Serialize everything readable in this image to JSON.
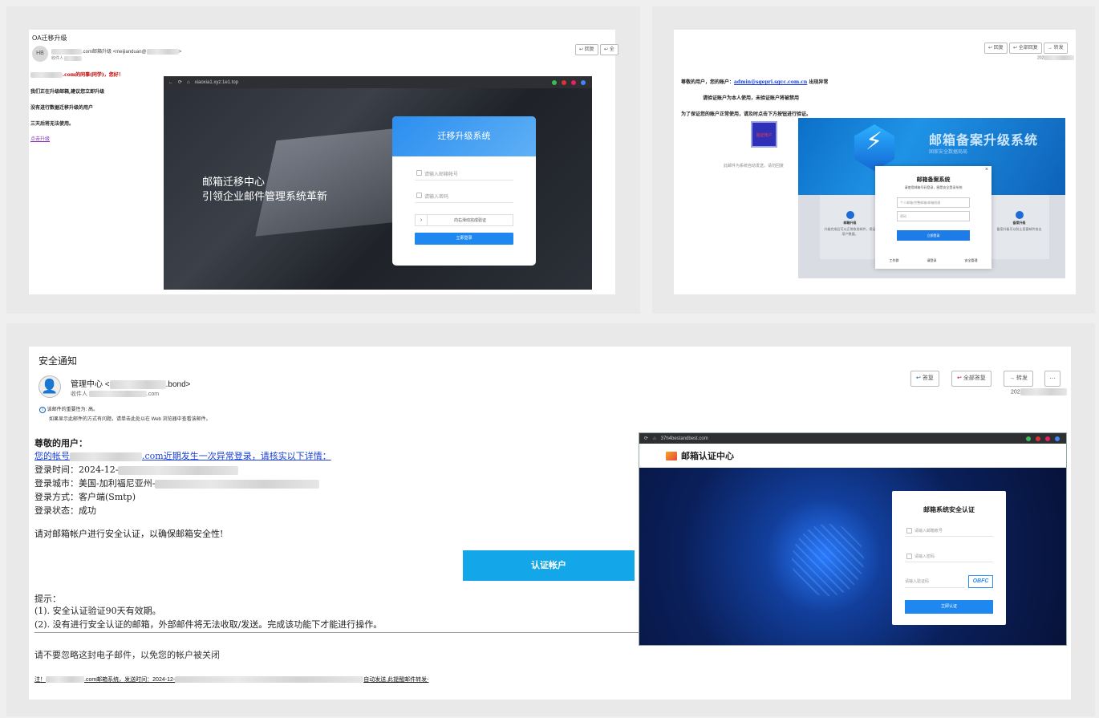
{
  "panel1": {
    "subject": "OA迁移升级",
    "avatar": "HB",
    "sender_domain": ".com邮箱升级 <meijianduan@",
    "sender_end": ">",
    "recipient_label": "收件人",
    "reply": "回复",
    "reply_all": "全",
    "greeting_suffix": ".com的同事(同学)，您好！",
    "line1": "我们正在升级邮箱,建议您立即升级",
    "line2": "没有进行数据迁移升级的用户",
    "line3": "三天后将无法使用。",
    "link": "点击升级",
    "browser_url": "xiaoxia1.xyz:1e1.top",
    "hero_title": "邮箱迁移中心",
    "hero_subtitle": "引领企业邮件管理系统革新",
    "login_title": "迁移升级系统",
    "username_placeholder": "请输入邮箱帐号",
    "password_placeholder": "请输入密码",
    "slider_label": "向右滑动完成验证",
    "login_button": "立即登录"
  },
  "panel2": {
    "reply": "回复",
    "reply_all": "全部回复",
    "forward": "转发",
    "year": "202",
    "line1_prefix": "尊敬的用户，您的账户：",
    "line1_email": "admin@sgepri.sgcc.com.cn",
    "line1_suffix": "出现异常",
    "line2": "请验证账户为本人使用，未验证账户将被禁用",
    "line3": "为了保证您的账户正常使用，请及时点击下方按钮进行验证。",
    "verify_btn": "验证账户",
    "footnote": "此邮件为系统自动发送，请勿回复",
    "banner_title": "邮箱备案升级系统",
    "banner_sub": "国家安全数据局局",
    "modal_title": "邮箱备案系统",
    "modal_sub": "请使用邮箱号码登录，圈是安全登录系统",
    "modal_user": "个人邮箱/完整邮箱/邮箱前缀",
    "modal_pass": "密码",
    "modal_btn": "立即登录",
    "modal_close": "×",
    "modal_links": [
      "工作群",
      "请登录",
      "安全管理"
    ],
    "side_left": "邮箱升级",
    "side_right": "备案升级",
    "side_left_desc": "升级完成后可以正常收发邮件，保证用户数据。",
    "side_right_desc": "备案升级可以防止恶意邮件攻击"
  },
  "panel3": {
    "subject": "安全通知",
    "sender_prefix": "管理中心 <",
    "sender_suffix": ".bond>",
    "recipient_label": "收件人",
    "recipient_suffix": ".com",
    "importance": "该邮件的重要性为: 高。",
    "display_hint": "如果显示此邮件的方式有问题，请单击此处以在 Web 浏览器中查看该邮件。",
    "reply": "答复",
    "reply_all": "全部答复",
    "forward": "转发",
    "more": "···",
    "year": "202",
    "greeting": "尊敬的用户：",
    "link_prefix": "您的帐号",
    "link_suffix": ".com近期发生一次异常登录，请核实以下详情：",
    "login_time": "登录时间：2024-12-",
    "login_city": "登录城市：美国-加利福尼亚州-",
    "login_method": "登录方式：客户端(Smtp)",
    "login_status": "登录状态：成功",
    "request": "请对邮箱帐户进行安全认证，以确保邮箱安全性!",
    "cta": "认证帐户",
    "tips_title": "提示：",
    "tip1": "(1). 安全认证验证90天有效期。",
    "tip2": "(2). 没有进行安全认证的邮箱，外部邮件将无法收取/发送。完成该功能下才能进行操作。",
    "warning": "请不要忽略这封电子邮件，以免您的帐户被关闭",
    "footer_prefix": "注！",
    "footer_mid": ".com邮箱系统，发送时间：2024-12-",
    "footer_suffix": "自动发送,此提醒邮件转发-",
    "browser_url": "37h4bestandbest.com",
    "site_title": "邮箱认证中心",
    "card_title": "邮箱系统安全认证",
    "card_user": "请输入邮箱帐号",
    "card_pass": "请输入密码",
    "card_captcha": "请输入验证码",
    "captcha_code": "OBFC",
    "card_button": "立即认证"
  }
}
